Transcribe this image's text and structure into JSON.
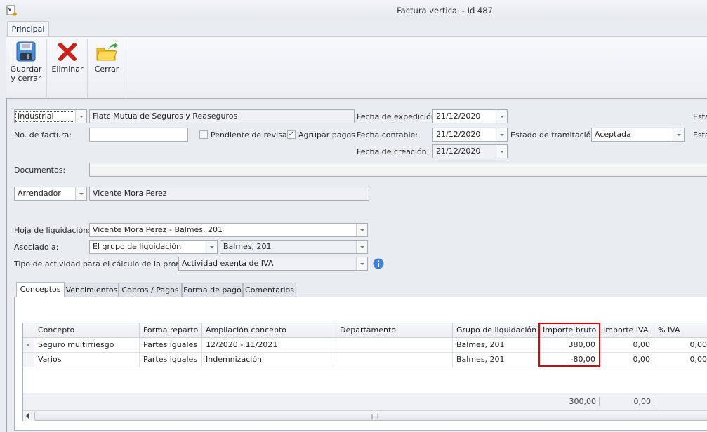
{
  "window": {
    "title": "Factura vertical - Id 487"
  },
  "ribbon": {
    "tab": "Principal",
    "buttons": [
      {
        "label1": "Guardar",
        "label2": "y cerrar"
      },
      {
        "label1": "Eliminar"
      },
      {
        "label1": "Cerrar"
      }
    ]
  },
  "form": {
    "entity_type": "Industrial",
    "entity_name": "Fiatc Mutua de Seguros y Reaseguros",
    "invoice_no_label": "No. de factura:",
    "invoice_no": "",
    "pending_label": "Pendiente de revisar",
    "pending_checked": false,
    "group_label": "Agrupar pagos",
    "group_checked": true,
    "fecha_exp_label": "Fecha de expedición:",
    "fecha_exp": "21/12/2020",
    "fecha_cont_label": "Fecha contable:",
    "fecha_cont": "21/12/2020",
    "fecha_crea_label": "Fecha de creación:",
    "fecha_crea": "21/12/2020",
    "estado_label": "Estado de tramitación:",
    "estado": "Aceptada",
    "esta1": "Esta",
    "esta2": "Esta",
    "documentos_label": "Documentos:",
    "documentos": "",
    "party_type": "Arrendador",
    "party_name": "Vicente Mora Perez",
    "hoja_label": "Hoja de liquidación:",
    "hoja": "Vicente Mora Perez - Balmes, 201",
    "asociado_label": "Asociado a:",
    "asociado": "El grupo de liquidación",
    "asociado_grupo": "Balmes, 201",
    "actividad_label": "Tipo de actividad para el cálculo de la prorrata:",
    "actividad": "Actividad exenta de IVA"
  },
  "tabs": [
    "Conceptos",
    "Vencimientos",
    "Cobros / Pagos",
    "Forma de pago",
    "Comentarios"
  ],
  "grid": {
    "columns": [
      "Concepto",
      "Forma reparto",
      "Ampliación concepto",
      "Departamento",
      "Grupo de liquidación",
      "Importe bruto",
      "Importe IVA",
      "% IVA"
    ],
    "rows": [
      [
        "Seguro multirriesgo",
        "Partes iguales",
        "12/2020 - 11/2021",
        "",
        "Balmes, 201",
        "380,00",
        "0,00",
        "0,00"
      ],
      [
        "Varios",
        "Partes iguales",
        "Indemnización",
        "",
        "Balmes, 201",
        "-80,00",
        "0,00",
        "0,00"
      ]
    ],
    "totals": {
      "importe_bruto": "300,00",
      "importe_iva": "0,00"
    }
  }
}
